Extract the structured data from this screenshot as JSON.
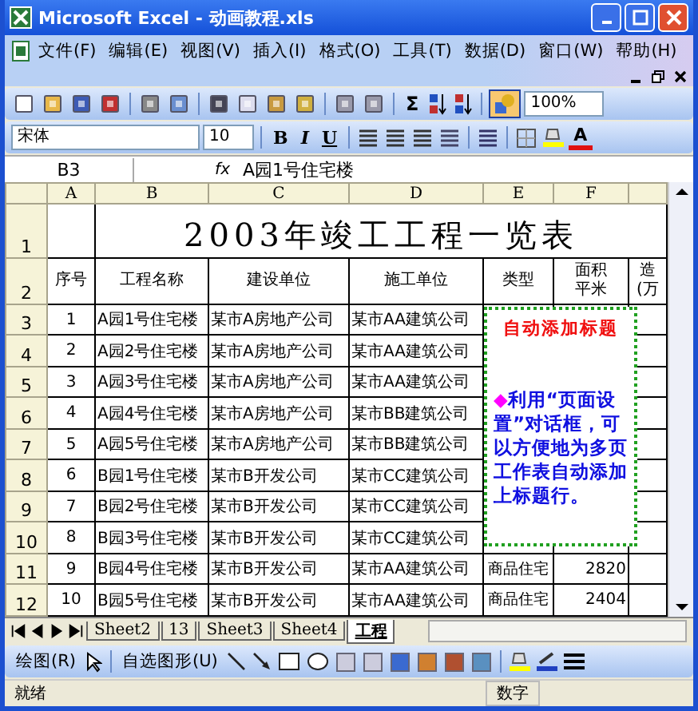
{
  "window": {
    "title": "Microsoft Excel - 动画教程.xls"
  },
  "menu": [
    "文件(F)",
    "编辑(E)",
    "视图(V)",
    "插入(I)",
    "格式(O)",
    "工具(T)",
    "数据(D)",
    "窗口(W)",
    "帮助(H)"
  ],
  "standard_toolbar": {
    "sum_label": "Σ",
    "drawing_toggle": {
      "on": true
    },
    "zoom": "100%"
  },
  "formatting_toolbar": {
    "font": "宋体",
    "size": "10",
    "bold": "B",
    "italic": "I",
    "underline": "U",
    "font_color": "A"
  },
  "formula_bar": {
    "name_box": "B3",
    "fx": "fx",
    "value": "A园1号住宅楼"
  },
  "sheet": {
    "columns": [
      "A",
      "B",
      "C",
      "D",
      "E",
      "F"
    ],
    "title": "2003年竣工工程一览表",
    "headers": [
      "序号",
      "工程名称",
      "建设单位",
      "施工单位",
      "类型",
      [
        "面积",
        "平米"
      ],
      [
        "造",
        "(万"
      ]
    ],
    "rows": [
      {
        "n": "3",
        "cells": [
          "1",
          "A园1号住宅楼",
          "某市A房地产公司",
          "某市AA建筑公司"
        ]
      },
      {
        "n": "4",
        "cells": [
          "2",
          "A园2号住宅楼",
          "某市A房地产公司",
          "某市AA建筑公司"
        ]
      },
      {
        "n": "5",
        "cells": [
          "3",
          "A园3号住宅楼",
          "某市A房地产公司",
          "某市AA建筑公司"
        ]
      },
      {
        "n": "6",
        "cells": [
          "4",
          "A园4号住宅楼",
          "某市A房地产公司",
          "某市BB建筑公司"
        ]
      },
      {
        "n": "7",
        "cells": [
          "5",
          "A园5号住宅楼",
          "某市A房地产公司",
          "某市BB建筑公司"
        ]
      },
      {
        "n": "8",
        "cells": [
          "6",
          "B园1号住宅楼",
          "某市B开发公司",
          "某市CC建筑公司"
        ]
      },
      {
        "n": "9",
        "cells": [
          "7",
          "B园2号住宅楼",
          "某市B开发公司",
          "某市CC建筑公司"
        ]
      },
      {
        "n": "10",
        "cells": [
          "8",
          "B园3号住宅楼",
          "某市B开发公司",
          "某市CC建筑公司"
        ]
      },
      {
        "n": "11",
        "cells": [
          "9",
          "B园4号住宅楼",
          "某市B开发公司",
          "某市AA建筑公司",
          "商品住宅",
          "2820"
        ]
      },
      {
        "n": "12",
        "cells": [
          "10",
          "B园5号住宅楼",
          "某市B开发公司",
          "某市AA建筑公司",
          "商品住宅",
          "2404"
        ]
      }
    ],
    "title_row": "1",
    "header_row": "2"
  },
  "comment": {
    "title": "自动添加标题",
    "bullet": "◆",
    "text": "利用“页面设置”对话框，可以方便地为多页工作表自动添加上标题行。"
  },
  "sheet_tabs": [
    {
      "label": "Sheet2",
      "selected": false
    },
    {
      "label": "13",
      "selected": false
    },
    {
      "label": "Sheet3",
      "selected": false
    },
    {
      "label": "Sheet4",
      "selected": false
    },
    {
      "label": "工程",
      "selected": true
    }
  ],
  "drawing_toolbar": {
    "draw": "绘图(R)",
    "autoshapes": "自选图形(U)"
  },
  "status_bar": {
    "status": "就绪",
    "mode": "数字"
  }
}
